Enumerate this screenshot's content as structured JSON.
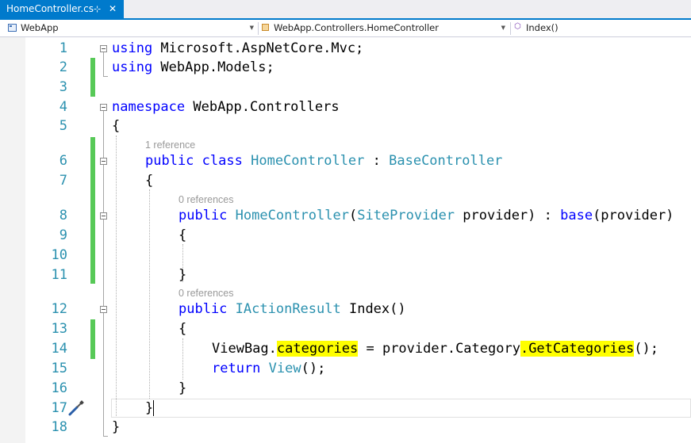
{
  "tab": {
    "title": "HomeController.cs",
    "pin_glyph": "⊹",
    "close_glyph": "✕"
  },
  "navbar": {
    "project": "WebApp",
    "class": "WebApp.Controllers.HomeController",
    "member": "Index()"
  },
  "lens": {
    "class_refs": "1 reference",
    "ctor_refs": "0 references",
    "index_refs": "0 references"
  },
  "line_numbers": [
    "1",
    "2",
    "3",
    "4",
    "5",
    "6",
    "7",
    "8",
    "9",
    "10",
    "11",
    "12",
    "13",
    "14",
    "15",
    "16",
    "17",
    "18"
  ],
  "code": {
    "l1_kw": "using",
    "l1_rest": " Microsoft.AspNetCore.Mvc;",
    "l2_kw": "using",
    "l2_rest": " WebApp.Models;",
    "l4_kw": "namespace",
    "l4_rest": " WebApp.Controllers",
    "l5": "{",
    "l6_kw1": "public",
    "l6_sp1": " ",
    "l6_kw2": "class",
    "l6_sp2": " ",
    "l6_ty1": "HomeController",
    "l6_colon": " : ",
    "l6_ty2": "BaseController",
    "l7": "{",
    "l8_kw1": "public",
    "l8_sp1": " ",
    "l8_ty1": "HomeController",
    "l8_p1": "(",
    "l8_ty2": "SiteProvider",
    "l8_p2": " provider) : ",
    "l8_kw2": "base",
    "l8_p3": "(provider)",
    "l9": "{",
    "l11": "}",
    "l12_kw": "public",
    "l12_sp": " ",
    "l12_ty": "IActionResult",
    "l12_rest": " Index()",
    "l13": "{",
    "l14_a": "ViewBag.",
    "l14_hl1": "categories",
    "l14_b": " = provider.Category",
    "l14_hl2": ".GetCategories",
    "l14_c": "();",
    "l15_kw": "return",
    "l15_sp": " ",
    "l15_ty": "View",
    "l15_rest": "();",
    "l16": "}",
    "l17": "}",
    "l18": "}"
  },
  "colors": {
    "keyword": "#0000ff",
    "type": "#2b91af",
    "line_number": "#2b91af",
    "change_bar": "#57c957",
    "highlight": "#ffff00",
    "tab_accent": "#007acc"
  },
  "icons": {
    "quick_action": "screwdriver-icon"
  }
}
